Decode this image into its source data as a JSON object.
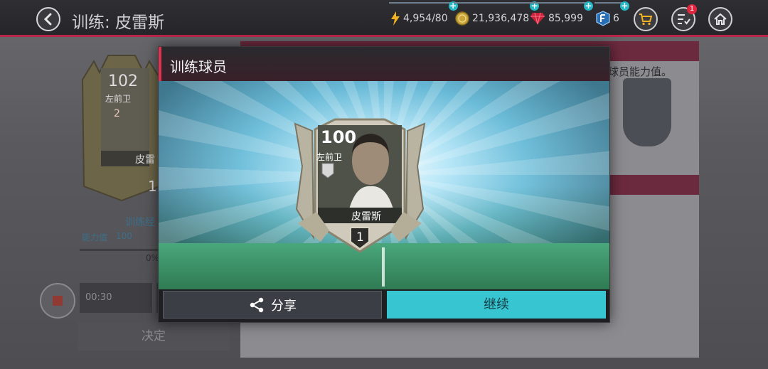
{
  "topbar": {
    "title": "训练: 皮雷斯",
    "energy": "4,954/80",
    "coins": "21,936,478",
    "gems": "85,999",
    "fifa_points": "6",
    "plus": "+",
    "notification_count": "1"
  },
  "background": {
    "card_rating": "102",
    "card_position": "左前卫",
    "card_rank": "2",
    "card_name": "皮雷",
    "card_level": "1",
    "training_label": "训练经",
    "ability_label": "能力值",
    "ability_value": "100",
    "percent": "0%",
    "timer_value": "00:30",
    "confirm_label": "决定",
    "hint_text": "球员能力值。"
  },
  "modal": {
    "title": "训练球员",
    "card": {
      "rating": "100",
      "position": "左前卫",
      "name": "皮雷斯",
      "level": "1"
    },
    "share_label": "分享",
    "continue_label": "继续"
  },
  "colors": {
    "accent": "#e0334f",
    "continue": "#37c6d1",
    "plus": "#27b8c6"
  }
}
